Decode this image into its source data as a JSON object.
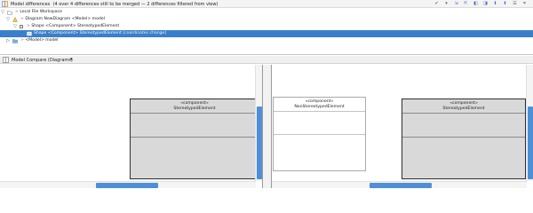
{
  "diff_panel": {
    "title": "Model differences",
    "summary": "(4 over 4 differences still to be merged — 2 differences filtered from view)",
    "toolbar": [
      {
        "icon": "check-green-icon",
        "glyph": "✔",
        "color": "#2e9b3a"
      },
      {
        "icon": "dropdown-icon",
        "glyph": "▾",
        "color": "#555555"
      },
      {
        "icon": "accept-all-icon",
        "glyph": "⇲",
        "color": "#3b6fb6"
      },
      {
        "icon": "reject-all-icon",
        "glyph": "⇱",
        "color": "#3b6fb6"
      },
      {
        "icon": "merge-left-icon",
        "glyph": "◧",
        "color": "#3b6fb6"
      },
      {
        "icon": "merge-right-icon",
        "glyph": "◨",
        "color": "#3b6fb6"
      },
      {
        "icon": "next-diff-icon",
        "glyph": "⬇",
        "color": "#3b6fb6"
      },
      {
        "icon": "prev-diff-icon",
        "glyph": "⬆",
        "color": "#3b6fb6"
      },
      {
        "icon": "group-icon",
        "glyph": "☰",
        "color": "#666666"
      },
      {
        "icon": "filter-icon",
        "glyph": "⏷",
        "color": "#666666"
      }
    ],
    "tree": [
      {
        "arrow": "▽",
        "prefix": ">",
        "label": "Local File Workspace",
        "extra": ""
      },
      {
        "arrow": "▽",
        "prefix": ">",
        "label": "Diagram NewDiagram <Model> model",
        "extra": ""
      },
      {
        "arrow": "▽",
        "prefix": ">",
        "label": "Shape <Component> StereotypedElement",
        "extra": ""
      },
      {
        "arrow": "",
        "prefix": "",
        "label": "Shape <Component> StereotypedElement",
        "extra": "[coordinates change]"
      },
      {
        "arrow": "▷",
        "prefix": ">",
        "label": "<Model> model",
        "extra": ""
      }
    ]
  },
  "compare": {
    "tab_label": "Model Compare (Diagrams)",
    "left": {
      "stereotype": "«component»",
      "name": "StereotypedElement"
    },
    "middle": {
      "stereotype": "«component»",
      "name": "NonStereotypedElement"
    },
    "right": {
      "stereotype": "«component»",
      "name": "StereotypedElement"
    }
  },
  "colors": {
    "selection": "#3a7fcc",
    "scroll_thumb": "#4f8fd8",
    "component_fill": "#d9d9d9"
  }
}
